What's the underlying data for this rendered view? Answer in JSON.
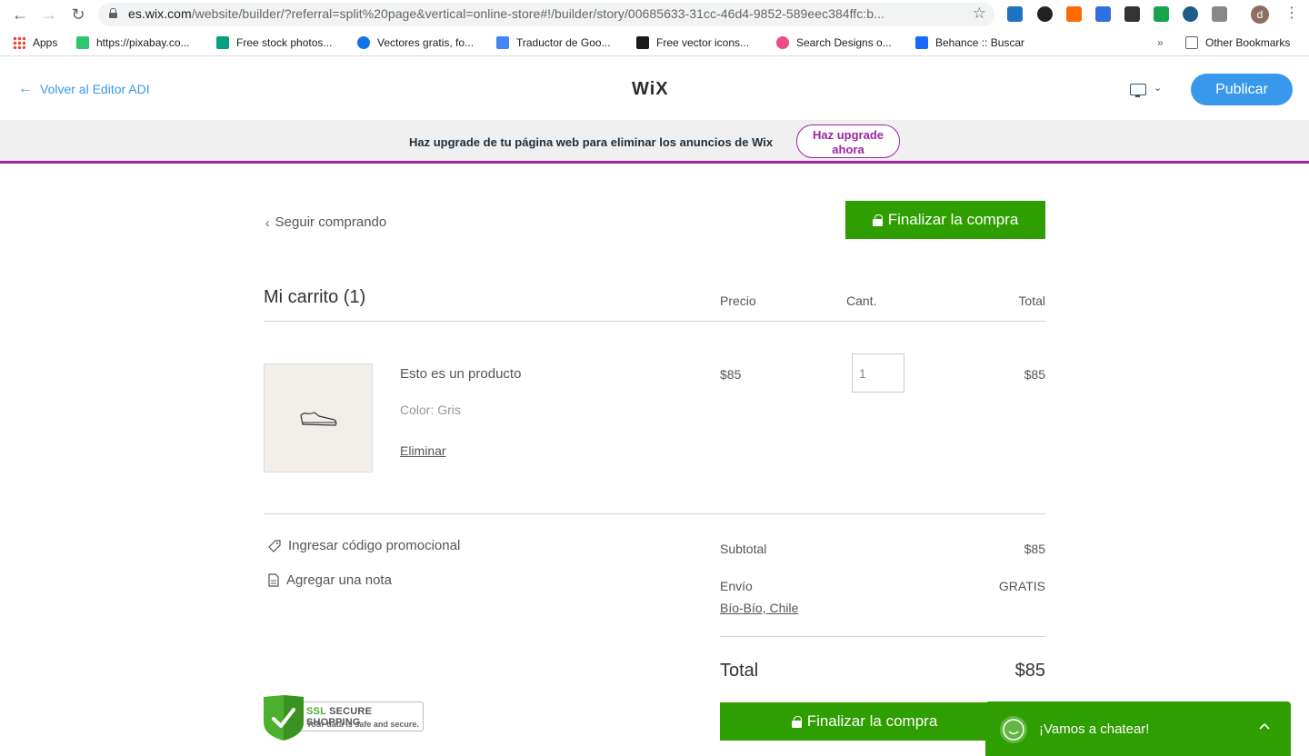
{
  "browser": {
    "url_host": "es.wix.com",
    "url_path": "/website/builder/?referral=split%20page&vertical=online-store#!/builder/story/00685633-31cc-46d4-9852-589eec384ffc:b...",
    "avatar_letter": "d"
  },
  "bookmarks": [
    {
      "label": "Apps",
      "color": "#e8453c"
    },
    {
      "label": "https://pixabay.co...",
      "color": "#2ec66d"
    },
    {
      "label": "Free stock photos...",
      "color": "#05a081"
    },
    {
      "label": "Vectores gratis, fo...",
      "color": "#1273eb"
    },
    {
      "label": "Traductor de Goo...",
      "color": "#4285f4"
    },
    {
      "label": "Free vector icons...",
      "color": "#1a1a1a"
    },
    {
      "label": "Search Designs o...",
      "color": "#ea4c89"
    },
    {
      "label": "Behance :: Buscar",
      "color": "#1769ff"
    }
  ],
  "bookmarks_more": "»",
  "bookmarks_other": "Other Bookmarks",
  "wix": {
    "back_label": "Volver al Editor ADI",
    "logo": "WiX",
    "publish_label": "Publicar"
  },
  "upgrade": {
    "text": "Haz upgrade de tu página web para eliminar los anuncios de Wix",
    "button": "Haz upgrade ahora"
  },
  "cart": {
    "continue_label": "Seguir comprando",
    "checkout_label": "Finalizar la compra",
    "title": "Mi carrito (1)",
    "col_price": "Precio",
    "col_qty": "Cant.",
    "col_total": "Total",
    "item": {
      "name": "Esto es un producto",
      "color": "Color: Gris",
      "remove": "Eliminar",
      "price": "$85",
      "qty": "1",
      "total": "$85"
    },
    "promo_label": "Ingresar código promocional",
    "note_label": "Agregar una nota",
    "subtotal_label": "Subtotal",
    "subtotal_value": "$85",
    "shipping_label": "Envío",
    "shipping_value": "GRATIS",
    "shipping_location": "Bío-Bío, Chile",
    "total_label": "Total",
    "total_value": "$85"
  },
  "ssl": {
    "title_a": "SSL",
    "title_b": "SECURE SHOPPING",
    "subtitle": "Your data is safe and secure."
  },
  "chat": {
    "label": "¡Vamos a chatear!"
  },
  "colors": {
    "accent": "#3899ec",
    "checkout_green": "#2f9e00",
    "upgrade_purple": "#9a27a3"
  }
}
